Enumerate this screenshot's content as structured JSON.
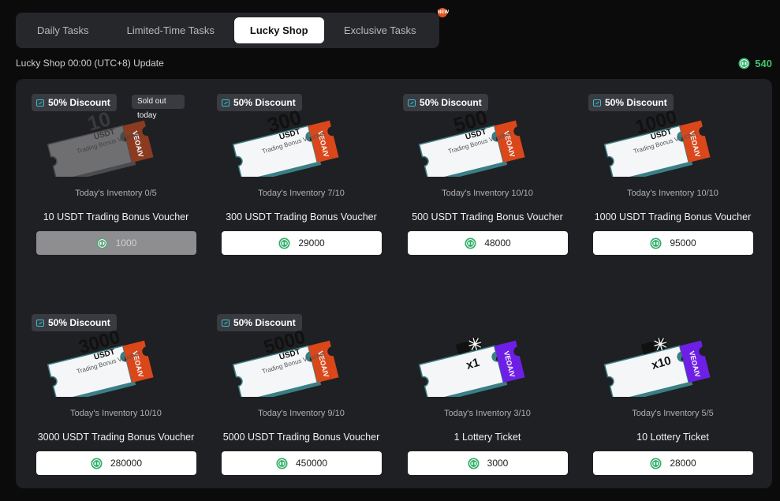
{
  "tabs": [
    {
      "label": "Daily Tasks",
      "active": false
    },
    {
      "label": "Limited-Time Tasks",
      "active": false
    },
    {
      "label": "Lucky Shop",
      "active": true
    },
    {
      "label": "Exclusive Tasks",
      "active": false,
      "badge": "NEW"
    }
  ],
  "shop": {
    "update_text": "Lucky Shop 00:00 (UTC+8) Update",
    "balance": "540"
  },
  "colors": {
    "brand_orange": "#d9471a",
    "brand_purple": "#6d1fe6",
    "coin_green": "#2fae67",
    "balance_green": "#3ec46d"
  },
  "items": [
    {
      "discount": "50% Discount",
      "soldout": "Sold out today",
      "ticket_value": "10",
      "ticket_unit": "USDT",
      "ticket_sub": "Trading Bonus Voucher",
      "brand": "VEOAIV",
      "inventory": "Today's Inventory 0/5",
      "title": "10 USDT Trading Bonus Voucher",
      "price": "1000",
      "disabled": true,
      "icon": "voucher-ticket-icon"
    },
    {
      "discount": "50% Discount",
      "ticket_value": "300",
      "ticket_unit": "USDT",
      "ticket_sub": "Trading Bonus Voucher",
      "brand": "VEOAIV",
      "inventory": "Today's Inventory 7/10",
      "title": "300 USDT Trading Bonus Voucher",
      "price": "29000",
      "icon": "voucher-ticket-icon"
    },
    {
      "discount": "50% Discount",
      "ticket_value": "500",
      "ticket_unit": "USDT",
      "ticket_sub": "Trading Bonus Voucher",
      "brand": "VEOAIV",
      "inventory": "Today's Inventory 10/10",
      "title": "500 USDT Trading Bonus Voucher",
      "price": "48000",
      "icon": "voucher-ticket-icon"
    },
    {
      "discount": "50% Discount",
      "ticket_value": "1000",
      "ticket_unit": "USDT",
      "ticket_sub": "Trading Bonus Voucher",
      "brand": "VEOAIV",
      "inventory": "Today's Inventory 10/10",
      "title": "1000 USDT Trading Bonus Voucher",
      "price": "95000",
      "icon": "voucher-ticket-icon"
    },
    {
      "discount": "50% Discount",
      "ticket_value": "3000",
      "ticket_unit": "USDT",
      "ticket_sub": "Trading Bonus Voucher",
      "brand": "VEOAIV",
      "inventory": "Today's Inventory 10/10",
      "title": "3000 USDT Trading Bonus Voucher",
      "price": "280000",
      "icon": "voucher-ticket-icon"
    },
    {
      "discount": "50% Discount",
      "ticket_value": "5000",
      "ticket_unit": "USDT",
      "ticket_sub": "Trading Bonus Voucher",
      "brand": "VEOAIV",
      "inventory": "Today's Inventory 9/10",
      "title": "5000 USDT Trading Bonus Voucher",
      "price": "450000",
      "icon": "voucher-ticket-icon"
    },
    {
      "lottery": true,
      "ticket_value": "x1",
      "brand": "VEOAIV",
      "inventory": "Today's Inventory 3/10",
      "title": "1 Lottery Ticket",
      "price": "3000",
      "icon": "lottery-ticket-icon"
    },
    {
      "lottery": true,
      "ticket_value": "x10",
      "brand": "VEOAIV",
      "inventory": "Today's Inventory 5/5",
      "title": "10 Lottery Ticket",
      "price": "28000",
      "icon": "lottery-ticket-icon"
    }
  ]
}
